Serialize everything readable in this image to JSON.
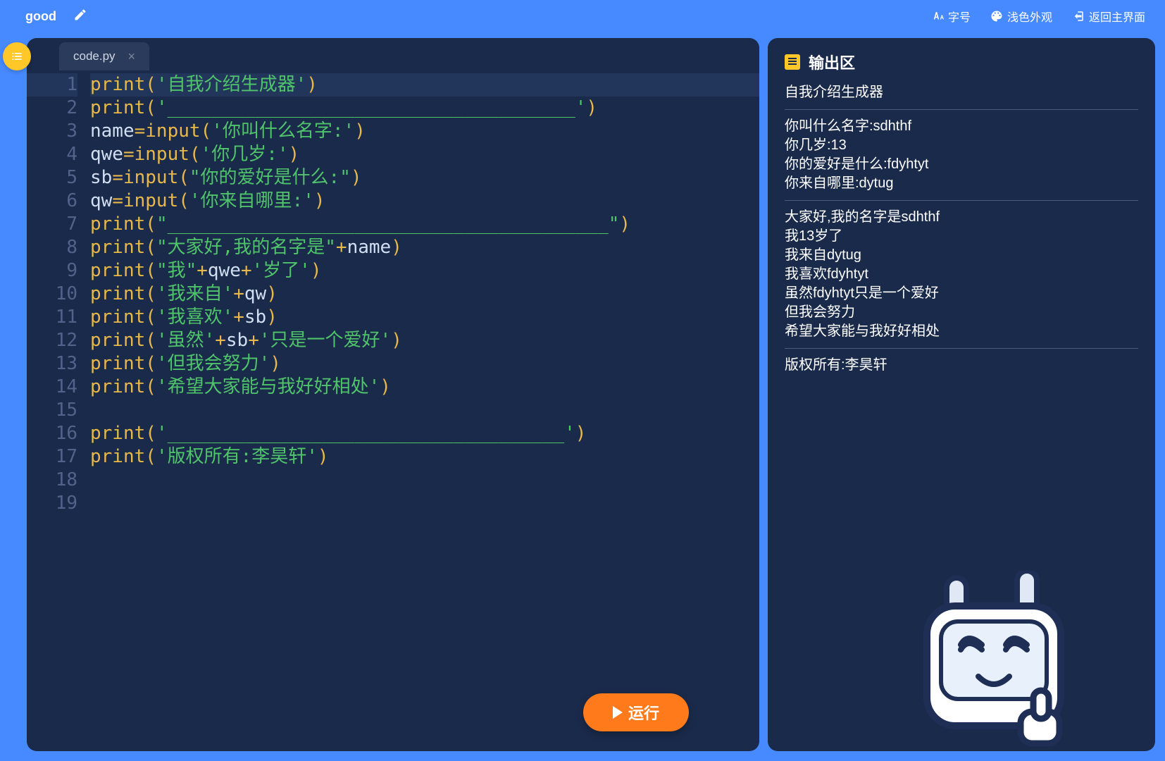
{
  "topbar": {
    "title": "good",
    "font_label": "字号",
    "theme_label": "浅色外观",
    "back_label": "返回主界面"
  },
  "tab": {
    "filename": "code.py"
  },
  "code": {
    "line_count": 19,
    "lines": [
      [
        [
          "func",
          "print"
        ],
        [
          "punct",
          "("
        ],
        [
          "str",
          "'自我介绍生成器'"
        ],
        [
          "punct",
          ")"
        ]
      ],
      [
        [
          "func",
          "print"
        ],
        [
          "punct",
          "("
        ],
        [
          "str",
          "'_____________________________________'"
        ],
        [
          "punct",
          ")"
        ]
      ],
      [
        [
          "var",
          "name"
        ],
        [
          "op",
          "="
        ],
        [
          "func",
          "input"
        ],
        [
          "punct",
          "("
        ],
        [
          "str",
          "'你叫什么名字:'"
        ],
        [
          "punct",
          ")"
        ]
      ],
      [
        [
          "var",
          "qwe"
        ],
        [
          "op",
          "="
        ],
        [
          "func",
          "input"
        ],
        [
          "punct",
          "("
        ],
        [
          "str",
          "'你几岁:'"
        ],
        [
          "punct",
          ")"
        ]
      ],
      [
        [
          "var",
          "sb"
        ],
        [
          "op",
          "="
        ],
        [
          "func",
          "input"
        ],
        [
          "punct",
          "("
        ],
        [
          "str",
          "\"你的爱好是什么:\""
        ],
        [
          "punct",
          ")"
        ]
      ],
      [
        [
          "var",
          "qw"
        ],
        [
          "op",
          "="
        ],
        [
          "func",
          "input"
        ],
        [
          "punct",
          "("
        ],
        [
          "str",
          "'你来自哪里:'"
        ],
        [
          "punct",
          ")"
        ]
      ],
      [
        [
          "func",
          "print"
        ],
        [
          "punct",
          "("
        ],
        [
          "str",
          "\"________________________________________\""
        ],
        [
          "punct",
          ")"
        ]
      ],
      [
        [
          "func",
          "print"
        ],
        [
          "punct",
          "("
        ],
        [
          "str",
          "\"大家好,我的名字是\""
        ],
        [
          "op",
          "+"
        ],
        [
          "var",
          "name"
        ],
        [
          "punct",
          ")"
        ]
      ],
      [
        [
          "func",
          "print"
        ],
        [
          "punct",
          "("
        ],
        [
          "str",
          "\"我\""
        ],
        [
          "op",
          "+"
        ],
        [
          "var",
          "qwe"
        ],
        [
          "op",
          "+"
        ],
        [
          "str",
          "'岁了'"
        ],
        [
          "punct",
          ")"
        ]
      ],
      [
        [
          "func",
          "print"
        ],
        [
          "punct",
          "("
        ],
        [
          "str",
          "'我来自'"
        ],
        [
          "op",
          "+"
        ],
        [
          "var",
          "qw"
        ],
        [
          "punct",
          ")"
        ]
      ],
      [
        [
          "func",
          "print"
        ],
        [
          "punct",
          "("
        ],
        [
          "str",
          "'我喜欢'"
        ],
        [
          "op",
          "+"
        ],
        [
          "var",
          "sb"
        ],
        [
          "punct",
          ")"
        ]
      ],
      [
        [
          "func",
          "print"
        ],
        [
          "punct",
          "("
        ],
        [
          "str",
          "'虽然'"
        ],
        [
          "op",
          "+"
        ],
        [
          "var",
          "sb"
        ],
        [
          "op",
          "+"
        ],
        [
          "str",
          "'只是一个爱好'"
        ],
        [
          "punct",
          ")"
        ]
      ],
      [
        [
          "func",
          "print"
        ],
        [
          "punct",
          "("
        ],
        [
          "str",
          "'但我会努力'"
        ],
        [
          "punct",
          ")"
        ]
      ],
      [
        [
          "func",
          "print"
        ],
        [
          "punct",
          "("
        ],
        [
          "str",
          "'希望大家能与我好好相处'"
        ],
        [
          "punct",
          ")"
        ]
      ],
      [],
      [
        [
          "func",
          "print"
        ],
        [
          "punct",
          "("
        ],
        [
          "str",
          "'____________________________________'"
        ],
        [
          "punct",
          ")"
        ]
      ],
      [
        [
          "func",
          "print"
        ],
        [
          "punct",
          "("
        ],
        [
          "str",
          "'版权所有:李昊轩'"
        ],
        [
          "punct",
          ")"
        ]
      ],
      [],
      []
    ],
    "highlighted_line": 1
  },
  "run_label": "运行",
  "output": {
    "title": "输出区",
    "blocks": [
      [
        "自我介绍生成器"
      ],
      [
        "你叫什么名字:sdhthf",
        "你几岁:13",
        "你的爱好是什么:fdyhtyt",
        "你来自哪里:dytug"
      ],
      [
        "大家好,我的名字是sdhthf",
        "我13岁了",
        "我来自dytug",
        "我喜欢fdyhtyt",
        "虽然fdyhtyt只是一个爱好",
        "但我会努力",
        "希望大家能与我好好相处"
      ],
      [
        "版权所有:李昊轩"
      ]
    ]
  }
}
